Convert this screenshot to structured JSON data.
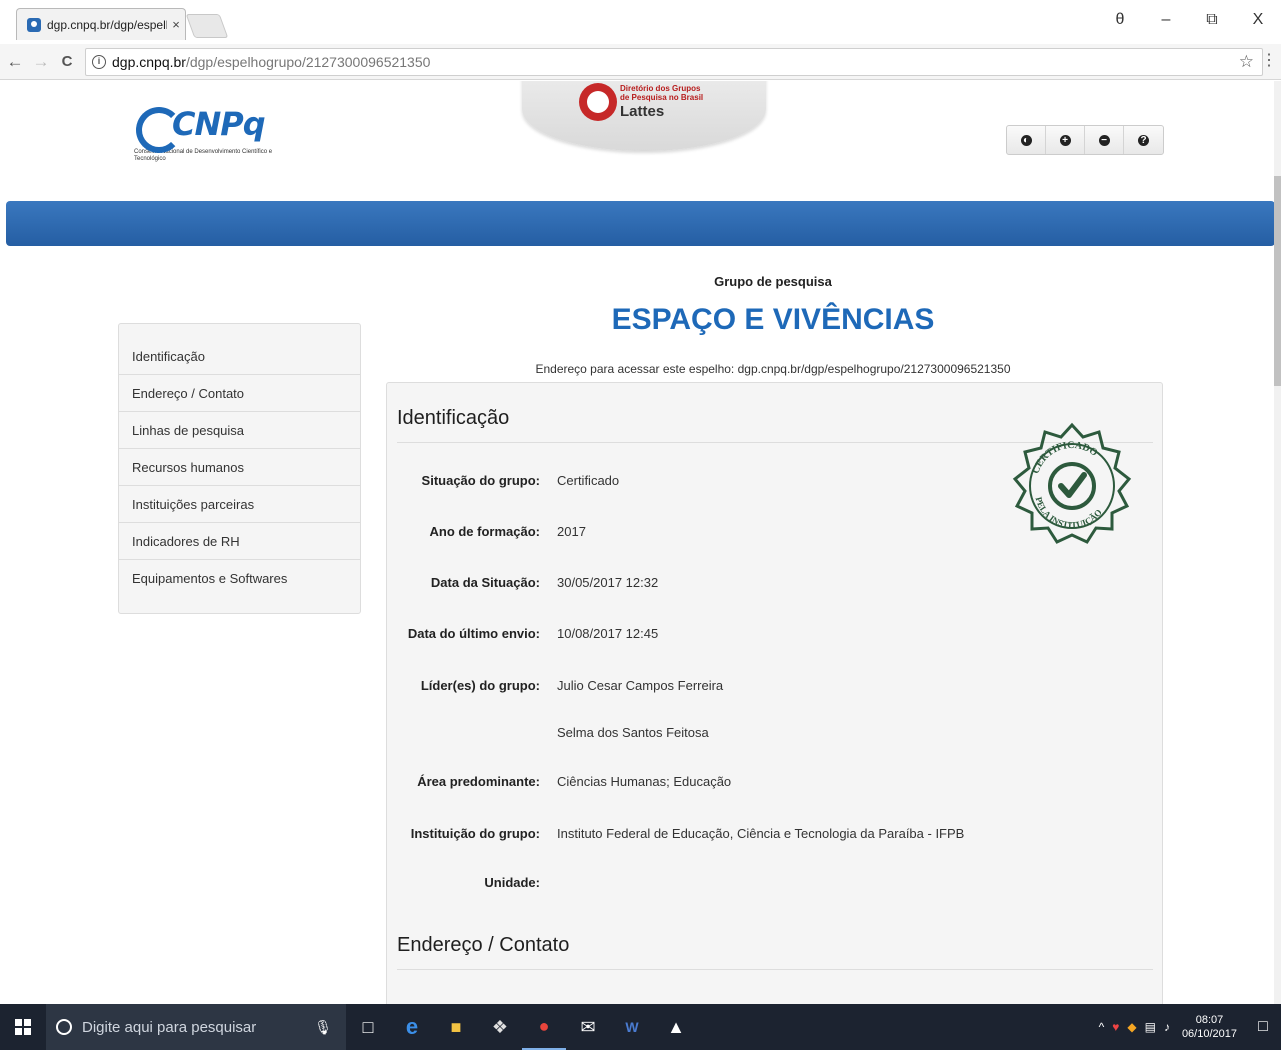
{
  "browser": {
    "tab_title": "dgp.cnpq.br/dgp/espelhc",
    "tab_close": "×",
    "url_host": "dgp.cnpq.br",
    "url_path": "/dgp/espelhogrupo/2127300096521350",
    "nav_back": "←",
    "nav_forward": "→",
    "nav_reload": "C",
    "window_controls": {
      "account": "θ",
      "minimize": "–",
      "restore": "⧉",
      "close": "X"
    },
    "star": "☆",
    "menu": "⋮"
  },
  "header": {
    "cnpq_name": "CNPq",
    "cnpq_subtitle": "Conselho Nacional de Desenvolvimento Científico e Tecnológico",
    "lattes_small_1": "Diretório dos Grupos",
    "lattes_small_2": "de Pesquisa no Brasil",
    "lattes_big": "Lattes",
    "accessibility_buttons": [
      "◐",
      "+",
      "−",
      "?"
    ]
  },
  "group": {
    "label": "Grupo de pesquisa",
    "title": "ESPAÇO E VIVÊNCIAS",
    "mirror_url": "Endereço para acessar este espelho: dgp.cnpq.br/dgp/espelhogrupo/2127300096521350"
  },
  "sidebar": {
    "items": [
      {
        "label": "Identificação"
      },
      {
        "label": "Endereço / Contato"
      },
      {
        "label": "Linhas de pesquisa"
      },
      {
        "label": "Recursos humanos"
      },
      {
        "label": "Instituições parceiras"
      },
      {
        "label": "Indicadores de RH"
      },
      {
        "label": "Equipamentos e Softwares"
      }
    ]
  },
  "identificacao": {
    "section_title": "Identificação",
    "seal_text_top": "CERTIFICADO",
    "seal_text_bottom": "PELA INSTITUIÇÃO",
    "fields": [
      {
        "label": "Situação do grupo:",
        "value": "Certificado"
      },
      {
        "label": "Ano de formação:",
        "value": "2017"
      },
      {
        "label": "Data da Situação:",
        "value": "30/05/2017 12:32"
      },
      {
        "label": "Data do último envio:",
        "value": "10/08/2017 12:45"
      },
      {
        "label": "Líder(es) do grupo:",
        "value": "Julio Cesar Campos Ferreira"
      },
      {
        "label": "",
        "value": "Selma dos Santos Feitosa"
      },
      {
        "label": "Área predominante:",
        "value": "Ciências Humanas; Educação"
      },
      {
        "label": "Instituição do grupo:",
        "value": "Instituto Federal de Educação, Ciência e Tecnologia da Paraíba - IFPB"
      },
      {
        "label": "Unidade:",
        "value": ""
      }
    ]
  },
  "endereco": {
    "section_title": "Endereço / Contato"
  },
  "taskbar": {
    "search_placeholder": "Digite aqui para pesquisar",
    "time": "08:07",
    "date": "06/10/2017"
  }
}
